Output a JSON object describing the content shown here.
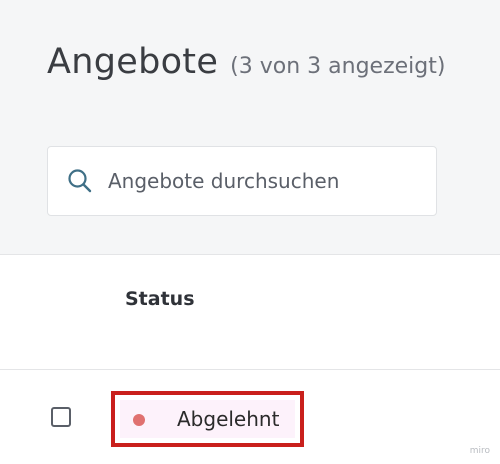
{
  "header": {
    "title": "Angebote",
    "count_text": "(3 von 3 angezeigt)"
  },
  "search": {
    "placeholder": "Angebote durchsuchen",
    "value": "",
    "icon": "search-icon"
  },
  "table": {
    "columns": [
      "Status"
    ],
    "rows": [
      {
        "selected": false,
        "status": "Abgelehnt",
        "status_color": "#e07170"
      }
    ]
  },
  "highlight_color": "#c9201c",
  "watermark": "miro"
}
